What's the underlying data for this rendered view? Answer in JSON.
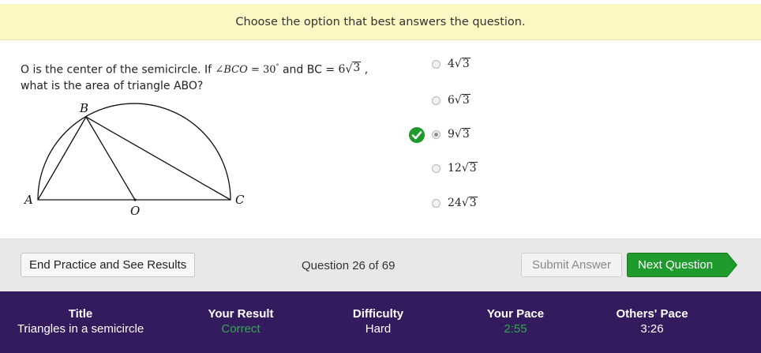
{
  "instruction": "Choose the option that best answers the question.",
  "question": {
    "text_part1": "O is the center of the semicircle. If ",
    "angle_symbol": "∠",
    "angle_name": "BCO",
    "angle_eq": " = 30",
    "degree": "°",
    "text_part2": " and BC = ",
    "bc_coef": "6",
    "bc_rad": "3",
    "comma": " ,",
    "text_line2": "what is the area of triangle ABO?"
  },
  "figure": {
    "label_a": "A",
    "label_b": "B",
    "label_c": "C",
    "label_o": "O"
  },
  "options": [
    {
      "coef": "4",
      "rad": "3",
      "selected": false
    },
    {
      "coef": "6",
      "rad": "3",
      "selected": false
    },
    {
      "coef": "9",
      "rad": "3",
      "selected": true
    },
    {
      "coef": "12",
      "rad": "3",
      "selected": false
    },
    {
      "coef": "24",
      "rad": "3",
      "selected": false
    }
  ],
  "toolbar": {
    "end_label": "End Practice and See Results",
    "progress": "Question 26 of 69",
    "submit_label": "Submit Answer",
    "next_label": "Next Question"
  },
  "footer": {
    "title_label": "Title",
    "title_value": "Triangles in a semicircle",
    "result_label": "Your Result",
    "result_value": "Correct",
    "difficulty_label": "Difficulty",
    "difficulty_value": "Hard",
    "pace_label": "Your Pace",
    "pace_value": "2:55",
    "others_label": "Others' Pace",
    "others_value": "3:26"
  },
  "colors": {
    "banner": "#fdf7c3",
    "footer": "#341b5e",
    "next_button": "#1f9a2c",
    "correct": "#2ea84a",
    "check": "#1f9a2c"
  },
  "icons": {
    "correct_mark": "check-circle-icon",
    "options": "radio-icon"
  }
}
